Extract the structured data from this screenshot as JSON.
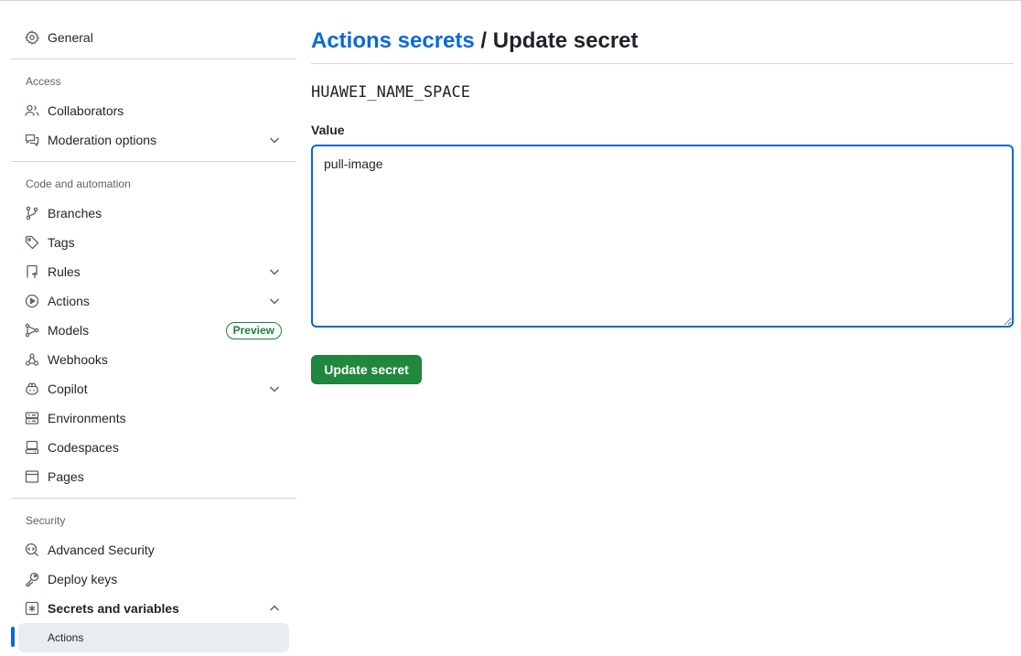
{
  "sidebar": {
    "general": {
      "label": "General",
      "icon": "gear-icon"
    },
    "sections": {
      "access": {
        "title": "Access"
      },
      "code": {
        "title": "Code and automation"
      },
      "security": {
        "title": "Security"
      }
    },
    "items": {
      "collaborators": {
        "label": "Collaborators",
        "icon": "people-icon"
      },
      "moderation": {
        "label": "Moderation options",
        "icon": "comment-discussion-icon"
      },
      "branches": {
        "label": "Branches",
        "icon": "git-branch-icon"
      },
      "tags": {
        "label": "Tags",
        "icon": "tag-icon"
      },
      "rules": {
        "label": "Rules",
        "icon": "repo-push-icon"
      },
      "actions": {
        "label": "Actions",
        "icon": "play-icon"
      },
      "models": {
        "label": "Models",
        "icon": "model-icon",
        "badge": "Preview"
      },
      "webhooks": {
        "label": "Webhooks",
        "icon": "webhook-icon"
      },
      "copilot": {
        "label": "Copilot",
        "icon": "copilot-icon"
      },
      "environments": {
        "label": "Environments",
        "icon": "server-icon"
      },
      "codespaces": {
        "label": "Codespaces",
        "icon": "codespaces-icon"
      },
      "pages": {
        "label": "Pages",
        "icon": "browser-icon"
      },
      "advanced_security": {
        "label": "Advanced Security",
        "icon": "codescan-icon"
      },
      "deploy_keys": {
        "label": "Deploy keys",
        "icon": "key-icon"
      },
      "secrets": {
        "label": "Secrets and variables",
        "icon": "asterisk-icon"
      },
      "secrets_actions": {
        "label": "Actions"
      }
    }
  },
  "main": {
    "breadcrumb_link": "Actions secrets",
    "breadcrumb_separator": " / ",
    "title": "Update secret",
    "secret_name": "HUAWEI_NAME_SPACE",
    "value_label": "Value",
    "value": "pull-image",
    "submit_label": "Update secret"
  },
  "colors": {
    "accent": "#0969da",
    "primary_button": "#1f883d",
    "badge": "#1a7f37",
    "muted_text": "#59636e",
    "border": "#d1d9e0"
  }
}
